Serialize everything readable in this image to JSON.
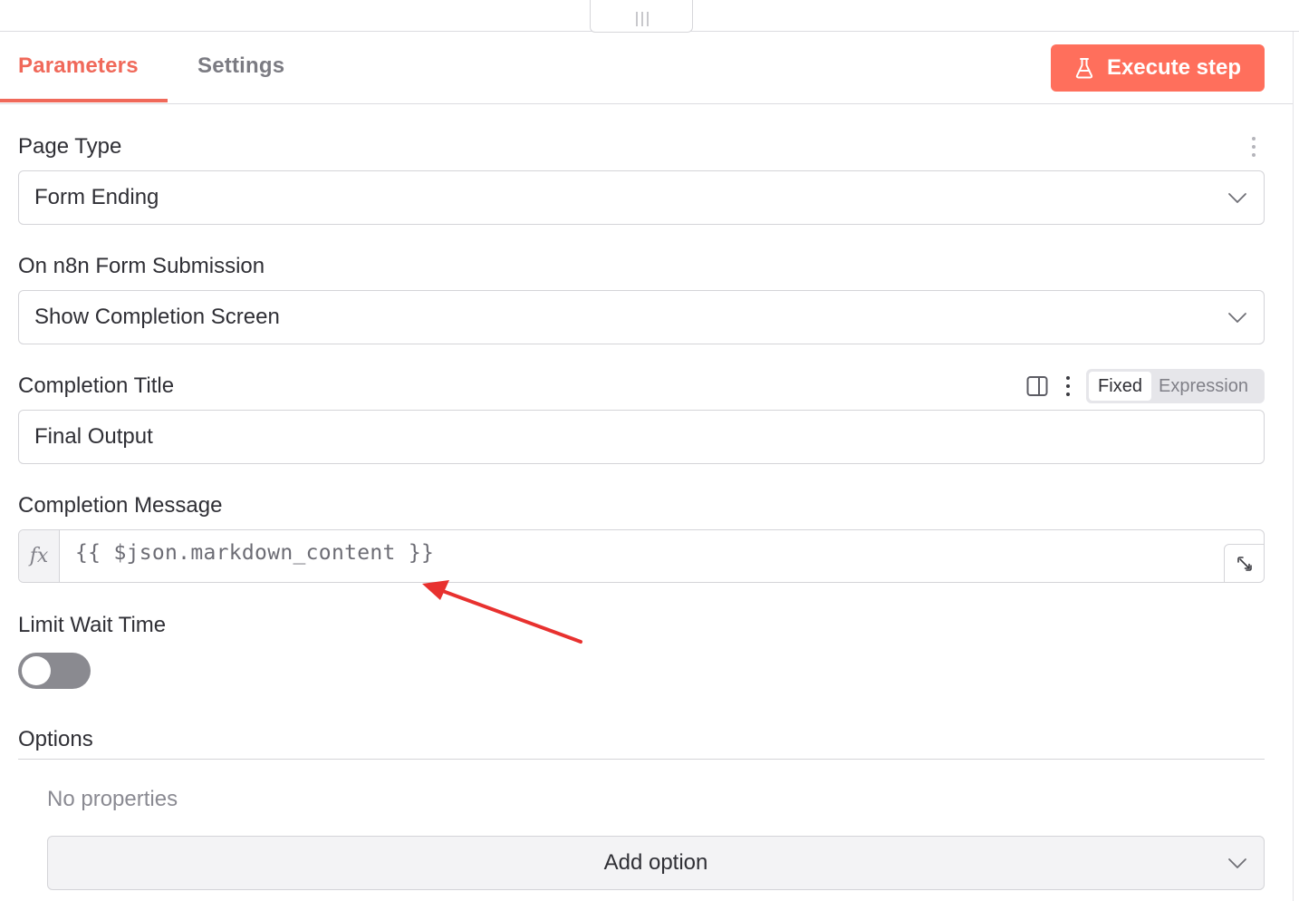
{
  "tabs": {
    "parameters": "Parameters",
    "settings": "Settings",
    "active": "Parameters"
  },
  "execute_button": {
    "label": "Execute step",
    "icon": "flask-icon"
  },
  "fields": {
    "page_type": {
      "label": "Page Type",
      "value": "Form Ending"
    },
    "on_submission": {
      "label": "On n8n Form Submission",
      "value": "Show Completion Screen"
    },
    "completion_title": {
      "label": "Completion Title",
      "value": "Final Output",
      "mode_fixed": "Fixed",
      "mode_expression": "Expression",
      "active_mode": "Fixed"
    },
    "completion_message": {
      "label": "Completion Message",
      "fx": "fx",
      "value": "{{ $json.markdown_content }}"
    },
    "limit_wait_time": {
      "label": "Limit Wait Time",
      "enabled": false
    }
  },
  "options": {
    "title": "Options",
    "empty_text": "No properties",
    "add_button": "Add option"
  },
  "colors": {
    "accent": "#ff6f5c",
    "accent_text": "#f0695a",
    "annotation_arrow": "#e8312f"
  }
}
